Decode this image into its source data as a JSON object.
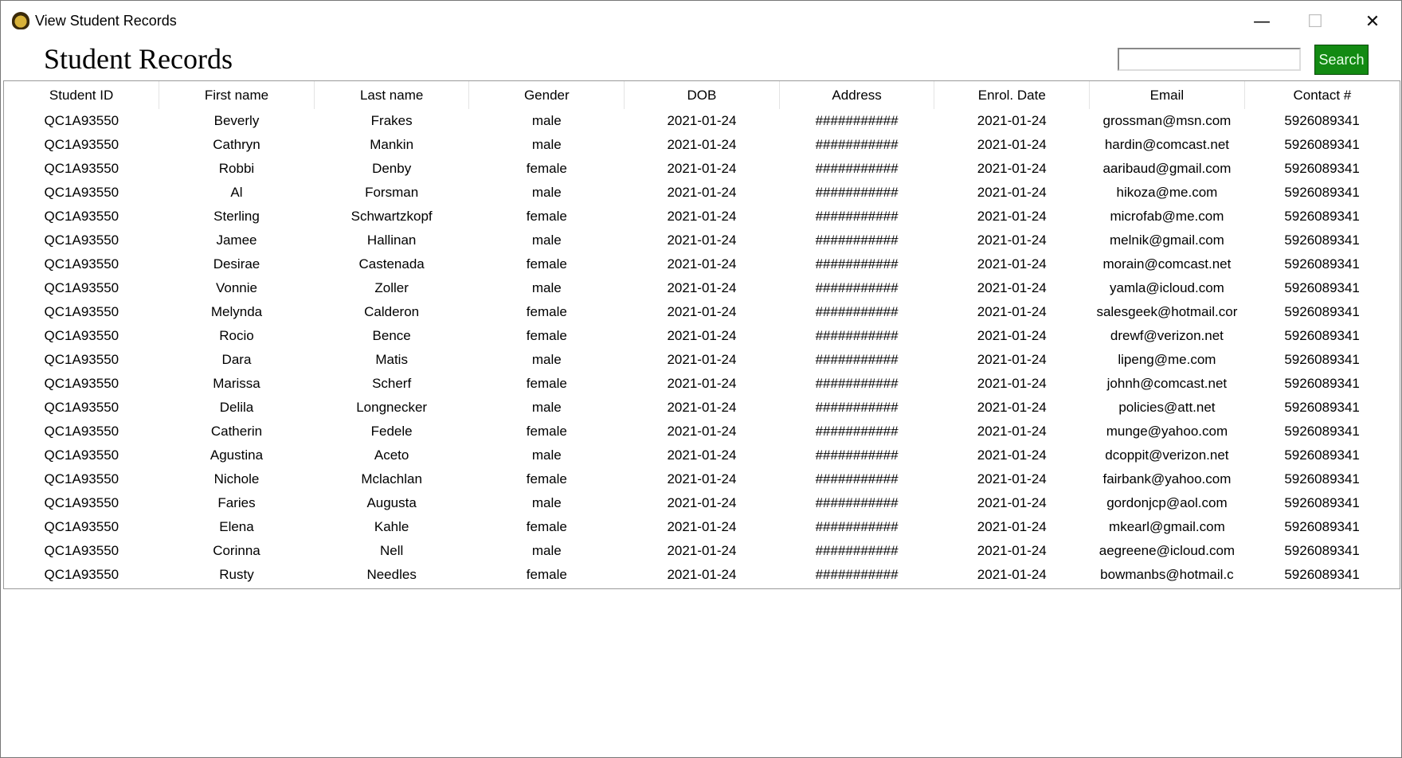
{
  "window": {
    "title": "View Student Records",
    "minimize": "—",
    "maximize": "☐",
    "close": "✕"
  },
  "heading": "Student Records",
  "search": {
    "value": "",
    "button": "Search"
  },
  "colors": {
    "search_button": "#138a13"
  },
  "columns": [
    "Student ID",
    "First name",
    "Last name",
    "Gender",
    "DOB",
    "Address",
    "Enrol. Date",
    "Email",
    "Contact #"
  ],
  "rows": [
    [
      "QC1A93550",
      "Beverly",
      "Frakes",
      "male",
      "2021-01-24",
      "###########",
      "2021-01-24",
      "grossman@msn.com",
      "5926089341"
    ],
    [
      "QC1A93550",
      "Cathryn",
      "Mankin",
      "male",
      "2021-01-24",
      "###########",
      "2021-01-24",
      "hardin@comcast.net",
      "5926089341"
    ],
    [
      "QC1A93550",
      "Robbi",
      "Denby",
      "female",
      "2021-01-24",
      "###########",
      "2021-01-24",
      "aaribaud@gmail.com",
      "5926089341"
    ],
    [
      "QC1A93550",
      "Al",
      "Forsman",
      "male",
      "2021-01-24",
      "###########",
      "2021-01-24",
      "hikoza@me.com",
      "5926089341"
    ],
    [
      "QC1A93550",
      "Sterling",
      "Schwartzkopf",
      "female",
      "2021-01-24",
      "###########",
      "2021-01-24",
      "microfab@me.com",
      "5926089341"
    ],
    [
      "QC1A93550",
      "Jamee",
      "Hallinan",
      "male",
      "2021-01-24",
      "###########",
      "2021-01-24",
      "melnik@gmail.com",
      "5926089341"
    ],
    [
      "QC1A93550",
      "Desirae",
      "Castenada",
      "female",
      "2021-01-24",
      "###########",
      "2021-01-24",
      "morain@comcast.net",
      "5926089341"
    ],
    [
      "QC1A93550",
      "Vonnie",
      "Zoller",
      "male",
      "2021-01-24",
      "###########",
      "2021-01-24",
      "yamla@icloud.com",
      "5926089341"
    ],
    [
      "QC1A93550",
      "Melynda",
      "Calderon",
      "female",
      "2021-01-24",
      "###########",
      "2021-01-24",
      "salesgeek@hotmail.cor",
      "5926089341"
    ],
    [
      "QC1A93550",
      "Rocio",
      "Bence",
      "female",
      "2021-01-24",
      "###########",
      "2021-01-24",
      "drewf@verizon.net",
      "5926089341"
    ],
    [
      "QC1A93550",
      "Dara",
      "Matis",
      "male",
      "2021-01-24",
      "###########",
      "2021-01-24",
      "lipeng@me.com",
      "5926089341"
    ],
    [
      "QC1A93550",
      "Marissa",
      "Scherf",
      "female",
      "2021-01-24",
      "###########",
      "2021-01-24",
      "johnh@comcast.net",
      "5926089341"
    ],
    [
      "QC1A93550",
      "Delila",
      "Longnecker",
      "male",
      "2021-01-24",
      "###########",
      "2021-01-24",
      "policies@att.net",
      "5926089341"
    ],
    [
      "QC1A93550",
      "Catherin",
      "Fedele",
      "female",
      "2021-01-24",
      "###########",
      "2021-01-24",
      "munge@yahoo.com",
      "5926089341"
    ],
    [
      "QC1A93550",
      "Agustina",
      "Aceto",
      "male",
      "2021-01-24",
      "###########",
      "2021-01-24",
      "dcoppit@verizon.net",
      "5926089341"
    ],
    [
      "QC1A93550",
      "Nichole",
      "Mclachlan",
      "female",
      "2021-01-24",
      "###########",
      "2021-01-24",
      "fairbank@yahoo.com",
      "5926089341"
    ],
    [
      "QC1A93550",
      "Faries",
      "Augusta",
      "male",
      "2021-01-24",
      "###########",
      "2021-01-24",
      "gordonjcp@aol.com",
      "5926089341"
    ],
    [
      "QC1A93550",
      "Elena",
      "Kahle",
      "female",
      "2021-01-24",
      "###########",
      "2021-01-24",
      "mkearl@gmail.com",
      "5926089341"
    ],
    [
      "QC1A93550",
      "Corinna",
      "Nell",
      "male",
      "2021-01-24",
      "###########",
      "2021-01-24",
      "aegreene@icloud.com",
      "5926089341"
    ],
    [
      "QC1A93550",
      "Rusty",
      "Needles",
      "female",
      "2021-01-24",
      "###########",
      "2021-01-24",
      "bowmanbs@hotmail.c",
      "5926089341"
    ]
  ]
}
